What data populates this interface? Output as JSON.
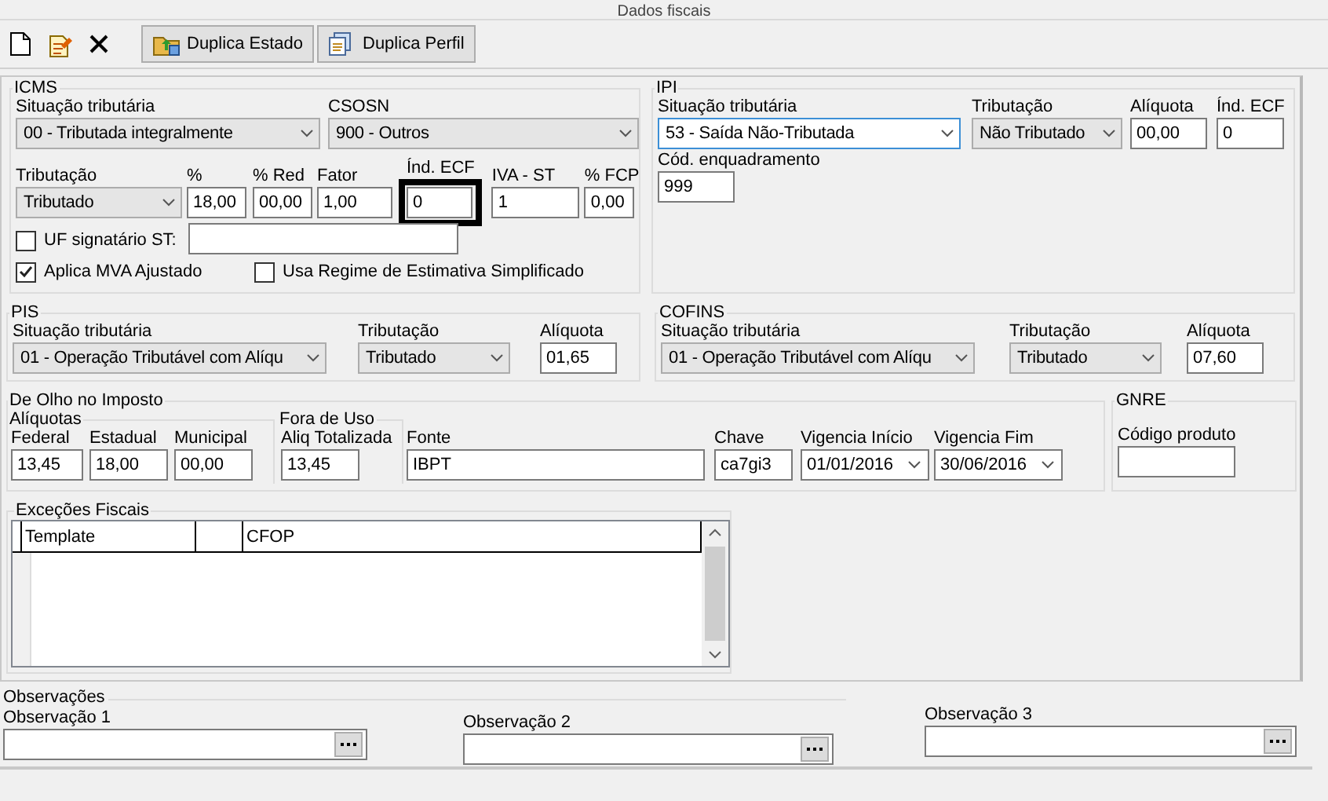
{
  "title": "Dados fiscais",
  "toolbar": [
    {
      "kind": "new"
    },
    {
      "kind": "edit"
    },
    {
      "kind": "delete"
    },
    {
      "kind": "copy_state",
      "label": "Duplica Estado"
    },
    {
      "kind": "copy_profile",
      "label": "Duplica Perfil"
    }
  ],
  "icms": {
    "title": "ICMS",
    "rows": [
      [
        {
          "kind": "select",
          "label": "Situação tributária",
          "value": "00 - Tributada integralmente",
          "focused": false
        },
        {
          "kind": "select",
          "label": "CSOSN",
          "value": "900 - Outros",
          "focused": false
        }
      ],
      [
        {
          "kind": "select",
          "label": "Tributação",
          "value": "Tributado",
          "focused": false
        },
        {
          "kind": "input",
          "label": "%",
          "value": "18,00"
        },
        {
          "kind": "input",
          "label": "% Red",
          "value": "00,00"
        },
        {
          "kind": "input",
          "label": "Fator",
          "value": "1,00"
        },
        {
          "kind": "input",
          "label": "Índ. ECF",
          "value": "0",
          "highlighted": true
        },
        {
          "kind": "input",
          "label": "IVA - ST",
          "value": "1"
        },
        {
          "kind": "input",
          "label": "% FCP",
          "value": "0,00"
        }
      ],
      [
        {
          "kind": "checkbox",
          "label": "UF signatário ST:",
          "checked": false
        },
        {
          "kind": "input"
        }
      ],
      [
        {
          "kind": "checkbox",
          "label": "Aplica MVA Ajustado",
          "checked": true
        },
        {
          "kind": "checkbox",
          "label": "Usa Regime de Estimativa Simplificado",
          "checked": false
        }
      ]
    ]
  },
  "ipi": {
    "title": "IPI",
    "rows": [
      [
        {
          "kind": "select",
          "label": "Situação tributária",
          "value": "53 - Saída Não-Tributada",
          "focused": true
        },
        {
          "kind": "select",
          "label": "Tributação",
          "value": "Não Tributado",
          "focused": false
        },
        {
          "kind": "input",
          "label": "Alíquota",
          "value": "00,00"
        },
        {
          "kind": "input",
          "label": "Índ. ECF",
          "value": "0"
        }
      ],
      [
        {
          "kind": "input",
          "label": "Cód. enquadramento",
          "value": "999"
        }
      ]
    ]
  },
  "pis": {
    "title": "PIS",
    "rows": [
      [
        {
          "kind": "select",
          "label": "Situação tributária",
          "value": "01 - Operação Tributável com Alíqu",
          "focused": false
        },
        {
          "kind": "select",
          "label": "Tributação",
          "value": "Tributado",
          "focused": false
        },
        {
          "kind": "input",
          "label": "Alíquota",
          "value": "01,65"
        }
      ]
    ]
  },
  "cofins": {
    "title": "COFINS",
    "rows": [
      [
        {
          "kind": "select",
          "label": "Situação tributária",
          "value": "01 - Operação Tributável com Alíqu",
          "focused": false
        },
        {
          "kind": "select",
          "label": "Tributação",
          "value": "Tributado",
          "focused": false
        },
        {
          "kind": "input",
          "label": "Alíquota",
          "value": "07,60"
        }
      ]
    ]
  },
  "de_olho": {
    "title": "De Olho no Imposto",
    "aliquotas": {
      "title": "Alíquotas",
      "fields": [
        {
          "kind": "input",
          "label": "Federal",
          "value": "13,45"
        },
        {
          "kind": "input",
          "label": "Estadual",
          "value": "18,00"
        },
        {
          "kind": "input",
          "label": "Municipal",
          "value": "00,00"
        }
      ]
    },
    "fora_de_uso": {
      "title": "Fora de Uso",
      "fields": [
        {
          "kind": "input",
          "label": "Aliq Totalizada",
          "value": "13,45"
        }
      ]
    },
    "fields": [
      {
        "kind": "input",
        "label": "Fonte",
        "value": "IBPT"
      },
      {
        "kind": "input",
        "label": "Chave",
        "value": "ca7gi3"
      },
      {
        "kind": "date",
        "label": "Vigencia Início",
        "value": "01/01/2016"
      },
      {
        "kind": "date",
        "label": "Vigencia Fim",
        "value": "30/06/2016"
      }
    ]
  },
  "gnre": {
    "title": "GNRE",
    "fields": [
      {
        "kind": "input",
        "label": "Código produto"
      }
    ]
  },
  "excecoes": {
    "title": "Exceções Fiscais",
    "columns": [
      "Template",
      "CFOP"
    ]
  },
  "observacoes": {
    "title": "Observações",
    "fields": [
      {
        "kind": "lookup",
        "label": "Observação 1"
      },
      {
        "kind": "lookup",
        "label": "Observação 2"
      },
      {
        "kind": "lookup",
        "label": "Observação 3"
      }
    ]
  }
}
